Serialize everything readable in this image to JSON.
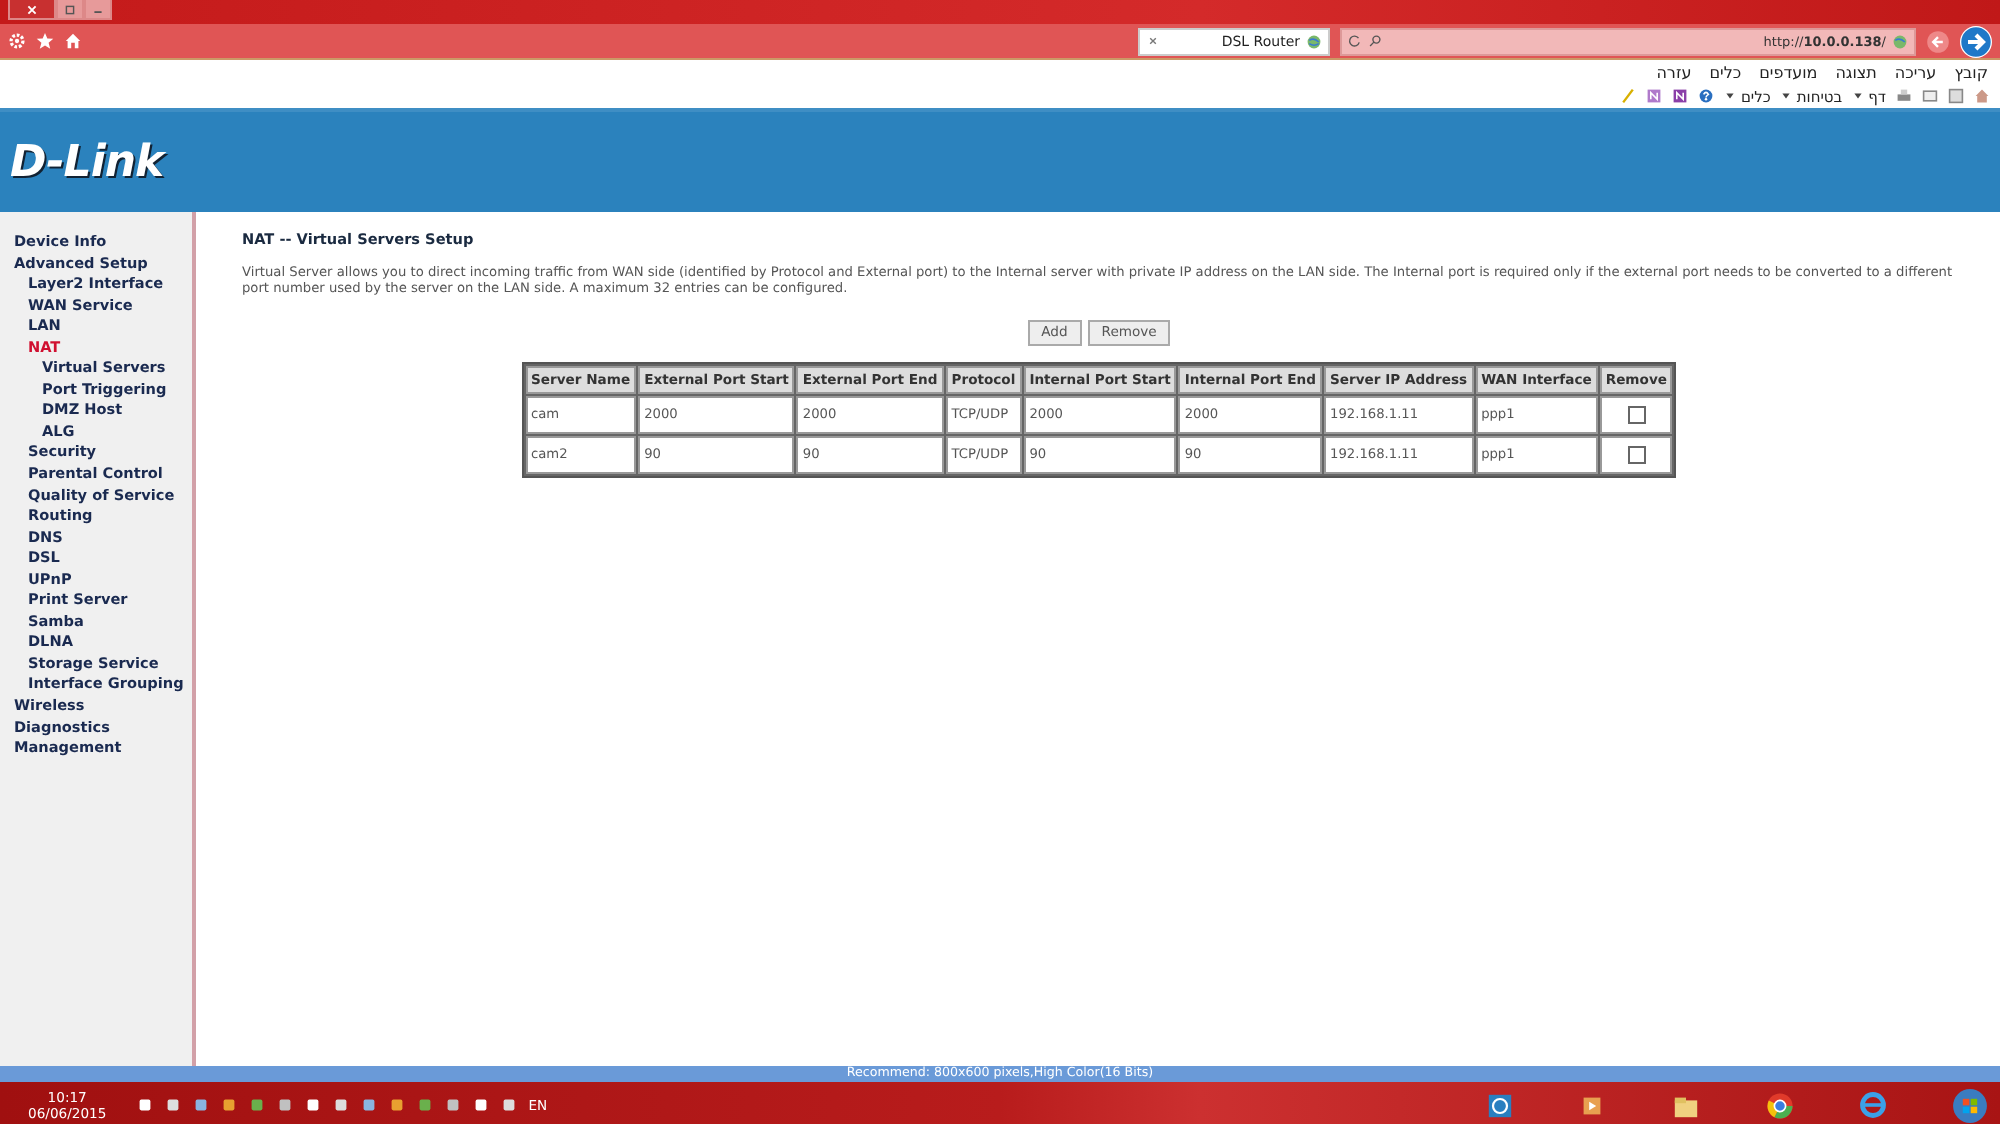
{
  "browser": {
    "address": "http://**10.0.0.138**/",
    "tab_title": "DSL Router",
    "menu": [
      "קובץ",
      "עריכה",
      "תצוגה",
      "מועדפים",
      "כלים",
      "עזרה"
    ],
    "command_bar": [
      "דף",
      "בטיחות",
      "כלים"
    ]
  },
  "banner": {
    "logo": "D-Link"
  },
  "sidebar": {
    "items": [
      {
        "label": "Device Info",
        "selected": false
      },
      {
        "label": "Advanced Setup",
        "selected": false,
        "children": [
          {
            "label": "Layer2 Interface",
            "selected": false
          },
          {
            "label": "WAN Service",
            "selected": false
          },
          {
            "label": "LAN",
            "selected": false
          },
          {
            "label": "NAT",
            "selected": true,
            "children": [
              {
                "label": "Virtual Servers",
                "selected": false
              },
              {
                "label": "Port Triggering",
                "selected": false
              },
              {
                "label": "DMZ Host",
                "selected": false
              },
              {
                "label": "ALG",
                "selected": false
              }
            ]
          },
          {
            "label": "Security",
            "selected": false
          },
          {
            "label": "Parental Control",
            "selected": false
          },
          {
            "label": "Quality of Service",
            "selected": false
          },
          {
            "label": "Routing",
            "selected": false
          },
          {
            "label": "DNS",
            "selected": false
          },
          {
            "label": "DSL",
            "selected": false
          },
          {
            "label": "UPnP",
            "selected": false
          },
          {
            "label": "Print Server",
            "selected": false
          },
          {
            "label": "Samba",
            "selected": false
          },
          {
            "label": "DLNA",
            "selected": false
          },
          {
            "label": "Storage Service",
            "selected": false
          },
          {
            "label": "Interface Grouping",
            "selected": false
          }
        ]
      },
      {
        "label": "Wireless",
        "selected": false
      },
      {
        "label": "Diagnostics",
        "selected": false
      },
      {
        "label": "Management",
        "selected": false
      }
    ]
  },
  "content": {
    "title": "NAT -- Virtual Servers Setup",
    "description": "Virtual Server allows you to direct incoming traffic from WAN side (identified by Protocol and External port) to the Internal server with private IP address on the LAN side. The Internal port is required only if the external port needs to be converted to a different port number used by the server on the LAN side. A maximum 32 entries can be configured.",
    "buttons": [
      "Add",
      "Remove"
    ],
    "table": {
      "columns": [
        "Server Name",
        "External Port Start",
        "External Port End",
        "Protocol",
        "Internal Port Start",
        "Internal Port End",
        "Server IP Address",
        "WAN Interface",
        "Remove"
      ],
      "rows": [
        {
          "cells": [
            "cam",
            "2000",
            "2000",
            "TCP/UDP",
            "2000",
            "2000",
            "192.168.1.11",
            "ppp1"
          ],
          "remove": false
        },
        {
          "cells": [
            "cam2",
            "90",
            "90",
            "TCP/UDP",
            "90",
            "90",
            "192.168.1.11",
            "ppp1"
          ],
          "remove": false
        }
      ]
    }
  },
  "status_line": "Recommend: 800x600 pixels,High Color(16 Bits)",
  "taskbar": {
    "time": "10:17",
    "date": "06/06/2015",
    "language": "EN"
  }
}
